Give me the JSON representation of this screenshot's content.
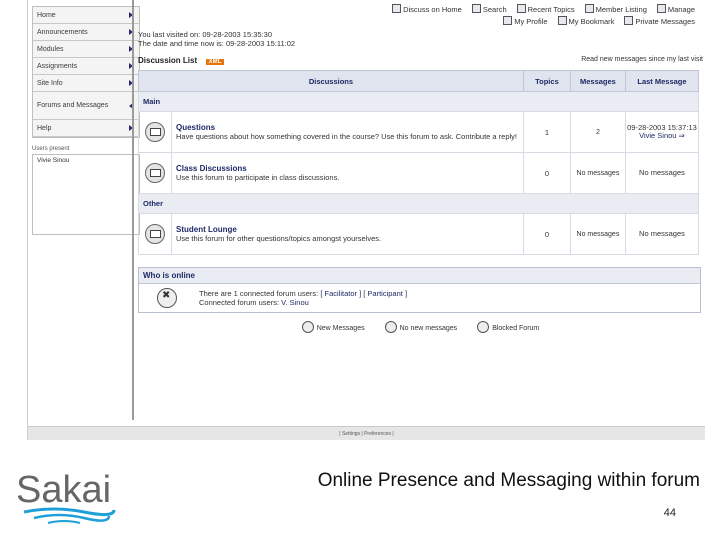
{
  "sidebar": {
    "items": [
      {
        "label": "Home",
        "arrow": "right"
      },
      {
        "label": "Announcements",
        "arrow": "right"
      },
      {
        "label": "Modules",
        "arrow": "right"
      },
      {
        "label": "Assignments",
        "arrow": "right"
      },
      {
        "label": "Site Info",
        "arrow": "right"
      },
      {
        "label": "Forums and Messages",
        "arrow": "left"
      },
      {
        "label": "Help",
        "arrow": "right"
      }
    ],
    "users_present_label": "Users present",
    "users_present": [
      "Vivie Sinou"
    ]
  },
  "topnav": {
    "row1": [
      "Discuss on Home",
      "Search",
      "Recent Topics",
      "Member Listing",
      "Manage"
    ],
    "row2": [
      "My Profile",
      "My Bookmark",
      "Private Messages"
    ]
  },
  "visit": {
    "last_visited": "You last visited on: 09-28-2003 15:35:30",
    "current_time": "The date and time now is: 09-28-2003 15:11:02"
  },
  "discussion_list": {
    "title": "Discussion List",
    "xml_badge": "XML",
    "read_new": "Read new messages since my last visit"
  },
  "table": {
    "headers": [
      "Discussions",
      "Topics",
      "Messages",
      "Last Message"
    ],
    "categories": [
      {
        "name": "Main",
        "forums": [
          {
            "name": "Questions",
            "desc": "Have questions about how something covered in the course? Use this forum to ask. Contribute a reply!",
            "topics": "1",
            "messages": "2",
            "last_line1": "09-28-2003 15:37:13",
            "last_line2": "Vivie Sinou ⇒"
          },
          {
            "name": "Class Discussions",
            "desc": "Use this forum to participate in class discussions.",
            "topics": "0",
            "messages": "No messages",
            "last_line1": "No messages",
            "last_line2": ""
          }
        ]
      },
      {
        "name": "Other",
        "forums": [
          {
            "name": "Student Lounge",
            "desc": "Use this forum for other questions/topics amongst yourselves.",
            "topics": "0",
            "messages": "No messages",
            "last_line1": "No messages",
            "last_line2": ""
          }
        ]
      }
    ]
  },
  "online": {
    "title": "Who is online",
    "line1_prefix": "There are 1 connected forum users:",
    "line1_roles": "[ Facilitator ] [ Participant ]",
    "line2_prefix": "Connected forum users:",
    "line2_user": "V. Sinou"
  },
  "legend": [
    "New Messages",
    "No new messages",
    "Blocked Forum"
  ],
  "footer": "| Settings | Preferences |",
  "slide": {
    "caption": "Online Presence and Messaging within forum",
    "page_number": "44",
    "logo_text": "Sakai"
  },
  "colors": {
    "header_bg": "#dfe4ee",
    "header_text": "#1e2a66",
    "logo_gray": "#666666",
    "logo_blue": "#1f9fd8",
    "xml_orange": "#e8740c"
  }
}
